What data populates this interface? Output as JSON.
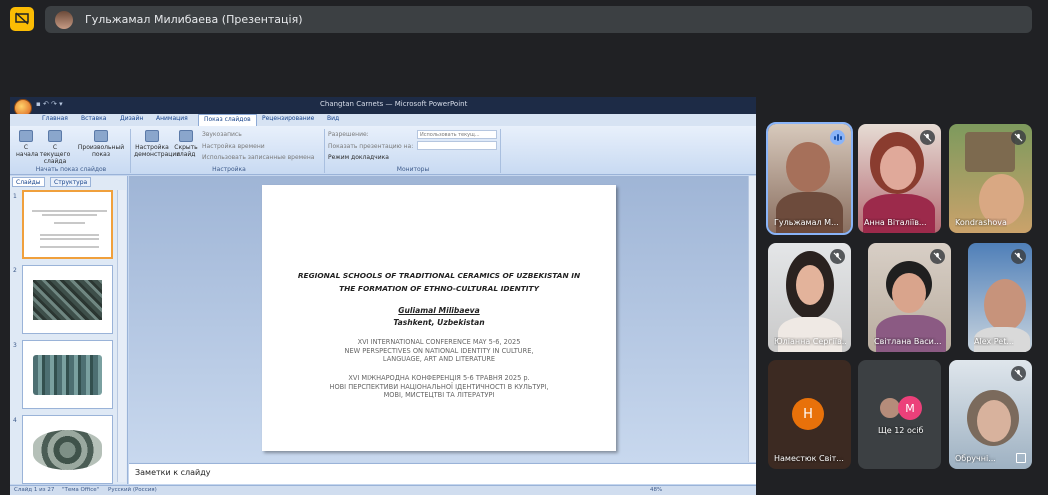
{
  "meet": {
    "presenter_label": "Гульжамал Милибаева (Презентація)"
  },
  "ppt": {
    "window_title": "Сhangtan Carnets — Microsoft PowerPoint",
    "tabs": [
      "Главная",
      "Вставка",
      "Дизайн",
      "Анимация",
      "Показ слайдов",
      "Рецензирование",
      "Вид"
    ],
    "active_tab": "Показ слайдов",
    "ribbon": {
      "from_start": "С начала",
      "from_current": "С текущего слайда",
      "custom_show": "Произвольный показ",
      "group_start": "Начать показ слайдов",
      "setup_show": "Настройка демонстрации",
      "hide_slide": "Скрыть слайд",
      "record": "Звукозапись",
      "rehearse": "Настройка времени",
      "use_timings": "Использовать записанные времена",
      "group_setup": "Настройка",
      "resolution": "Разрешение:",
      "resolution_value": "Использовать текущ...",
      "show_on": "Показать презентацию на:",
      "presenter_view": "Режим докладчика",
      "group_monitors": "Мониторы"
    },
    "panel_tabs": [
      "Слайды",
      "Структура"
    ],
    "slide": {
      "title_line1": "REGIONAL SCHOOLS OF TRADITIONAL  CERAMICS OF UZBEKISTAN IN",
      "title_line2": "THE  FORMATION OF ETHNO-CULTURAL IDENTITY",
      "author": "Guliamal Milibaeva",
      "location": "Tashkent, Uzbekistan",
      "conf_en_1": "XVI INTERNATIONAL CONFERENCE MAY 5-6, 2025",
      "conf_en_2": "NEW PERSPECTIVES ON NATIONAL IDENTITY  IN CULTURE,",
      "conf_en_3": "LANGUAGE, ART AND  LITERATURE",
      "conf_ua_1": "XVI МІЖНАРОДНА КОНФЕРЕНЦІЯ 5-6 ТРАВНЯ 2025 р.",
      "conf_ua_2": "НОВІ ПЕРСПЕКТИВИ НАЦІОНАЛЬНОЇ  ІДЕНТИЧНОСТІ  В КУЛЬТУРІ,",
      "conf_ua_3": "МОВІ,  МИСТЕЦТВІ ТА ЛІТЕРАТУРІ"
    },
    "thumb_numbers": [
      "1",
      "2",
      "3",
      "4"
    ],
    "notes_placeholder": "Заметки к слайду",
    "status": {
      "slide_count": "Слайд 1 из 27",
      "theme": "\"Тема Office\"",
      "language": "Русский (Россия)",
      "zoom": "48%"
    }
  },
  "participants": [
    {
      "name": "Гульжамал М...",
      "muted": false,
      "speaking": true
    },
    {
      "name": "Анна Віталіїв...",
      "muted": true
    },
    {
      "name": "Kondrashova",
      "muted": true
    },
    {
      "name": "Юліанна Сергіїв...",
      "muted": true
    },
    {
      "name": "Світлана Васи...",
      "muted": true
    },
    {
      "name": "Alex Pet...",
      "muted": true
    },
    {
      "name": "Наместюк Світ...",
      "initial": "Н",
      "color": "#e8710a"
    },
    {
      "name": "Ще 12 осіб",
      "initial": "M",
      "color": "#ec407a"
    },
    {
      "name": "Обручні...",
      "muted": true
    }
  ]
}
